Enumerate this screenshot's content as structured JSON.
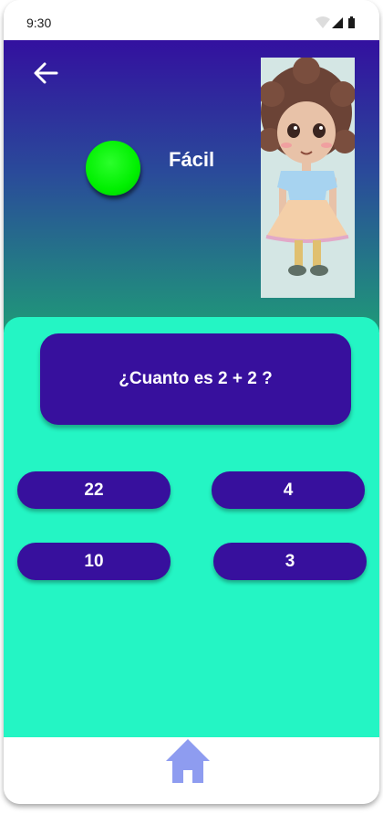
{
  "status_bar": {
    "time": "9:30",
    "icons": [
      "wifi-icon",
      "signal-icon",
      "battery-icon"
    ]
  },
  "header": {
    "back_icon": "arrow-left-icon",
    "difficulty_label": "Fácil",
    "difficulty_color": "#00f000",
    "avatar_alt": "cartoon-girl-illustration"
  },
  "quiz": {
    "question": "¿Cuanto es 2 + 2 ?",
    "answers": [
      "22",
      "4",
      "10",
      "3"
    ]
  },
  "nav": {
    "home_icon": "home-icon"
  },
  "colors": {
    "primary": "#37109d",
    "panel": "#24f5c4",
    "nav_icon": "#8e9cf0"
  }
}
